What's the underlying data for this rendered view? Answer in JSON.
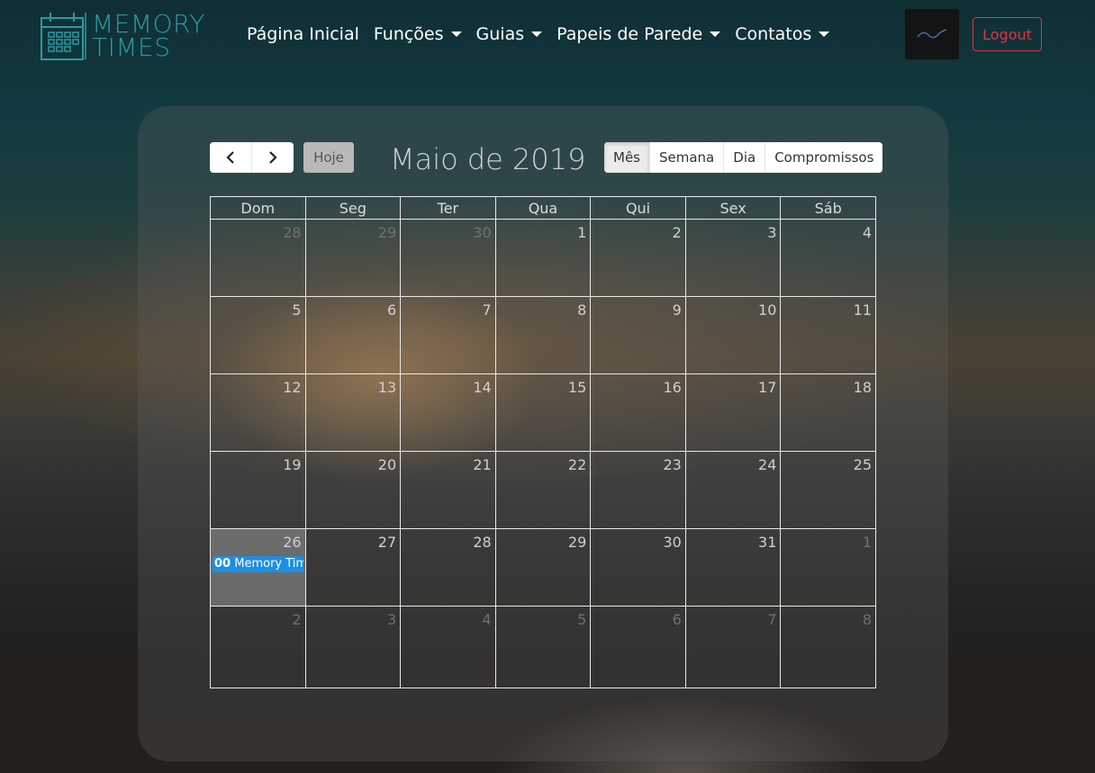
{
  "brand": {
    "line1": "MEMORY",
    "line2": "TIMES"
  },
  "nav": {
    "items": [
      {
        "label": "Página Inicial",
        "dropdown": false
      },
      {
        "label": "Funções",
        "dropdown": true
      },
      {
        "label": "Guias",
        "dropdown": true
      },
      {
        "label": "Papeis de Parede",
        "dropdown": true
      },
      {
        "label": "Contatos",
        "dropdown": true
      }
    ],
    "logout_label": "Logout"
  },
  "calendar": {
    "today_label": "Hoje",
    "title": "Maio de 2019",
    "views": [
      {
        "label": "Mês",
        "active": true
      },
      {
        "label": "Semana",
        "active": false
      },
      {
        "label": "Dia",
        "active": false
      },
      {
        "label": "Compromissos",
        "active": false
      }
    ],
    "weekdays": [
      "Dom",
      "Seg",
      "Ter",
      "Qua",
      "Qui",
      "Sex",
      "Sáb"
    ],
    "weeks": [
      [
        {
          "d": "28",
          "other": true
        },
        {
          "d": "29",
          "other": true
        },
        {
          "d": "30",
          "other": true
        },
        {
          "d": "1"
        },
        {
          "d": "2"
        },
        {
          "d": "3"
        },
        {
          "d": "4"
        }
      ],
      [
        {
          "d": "5"
        },
        {
          "d": "6"
        },
        {
          "d": "7"
        },
        {
          "d": "8"
        },
        {
          "d": "9"
        },
        {
          "d": "10"
        },
        {
          "d": "11"
        }
      ],
      [
        {
          "d": "12"
        },
        {
          "d": "13"
        },
        {
          "d": "14"
        },
        {
          "d": "15"
        },
        {
          "d": "16"
        },
        {
          "d": "17"
        },
        {
          "d": "18"
        }
      ],
      [
        {
          "d": "19"
        },
        {
          "d": "20"
        },
        {
          "d": "21"
        },
        {
          "d": "22"
        },
        {
          "d": "23"
        },
        {
          "d": "24"
        },
        {
          "d": "25"
        }
      ],
      [
        {
          "d": "26",
          "today": true,
          "event": {
            "time": "00",
            "title": "Memory Times"
          }
        },
        {
          "d": "27"
        },
        {
          "d": "28"
        },
        {
          "d": "29"
        },
        {
          "d": "30"
        },
        {
          "d": "31"
        },
        {
          "d": "1",
          "other": true
        }
      ],
      [
        {
          "d": "2",
          "other": true
        },
        {
          "d": "3",
          "other": true
        },
        {
          "d": "4",
          "other": true
        },
        {
          "d": "5",
          "other": true
        },
        {
          "d": "6",
          "other": true
        },
        {
          "d": "7",
          "other": true
        },
        {
          "d": "8",
          "other": true
        }
      ]
    ]
  },
  "icons": {
    "prev": "chevron-left-icon",
    "next": "chevron-right-icon",
    "logo": "calendar-icon"
  },
  "colors": {
    "brand": "#2c9aa3",
    "logout": "#dc3545",
    "event": "#1e8fe0"
  }
}
